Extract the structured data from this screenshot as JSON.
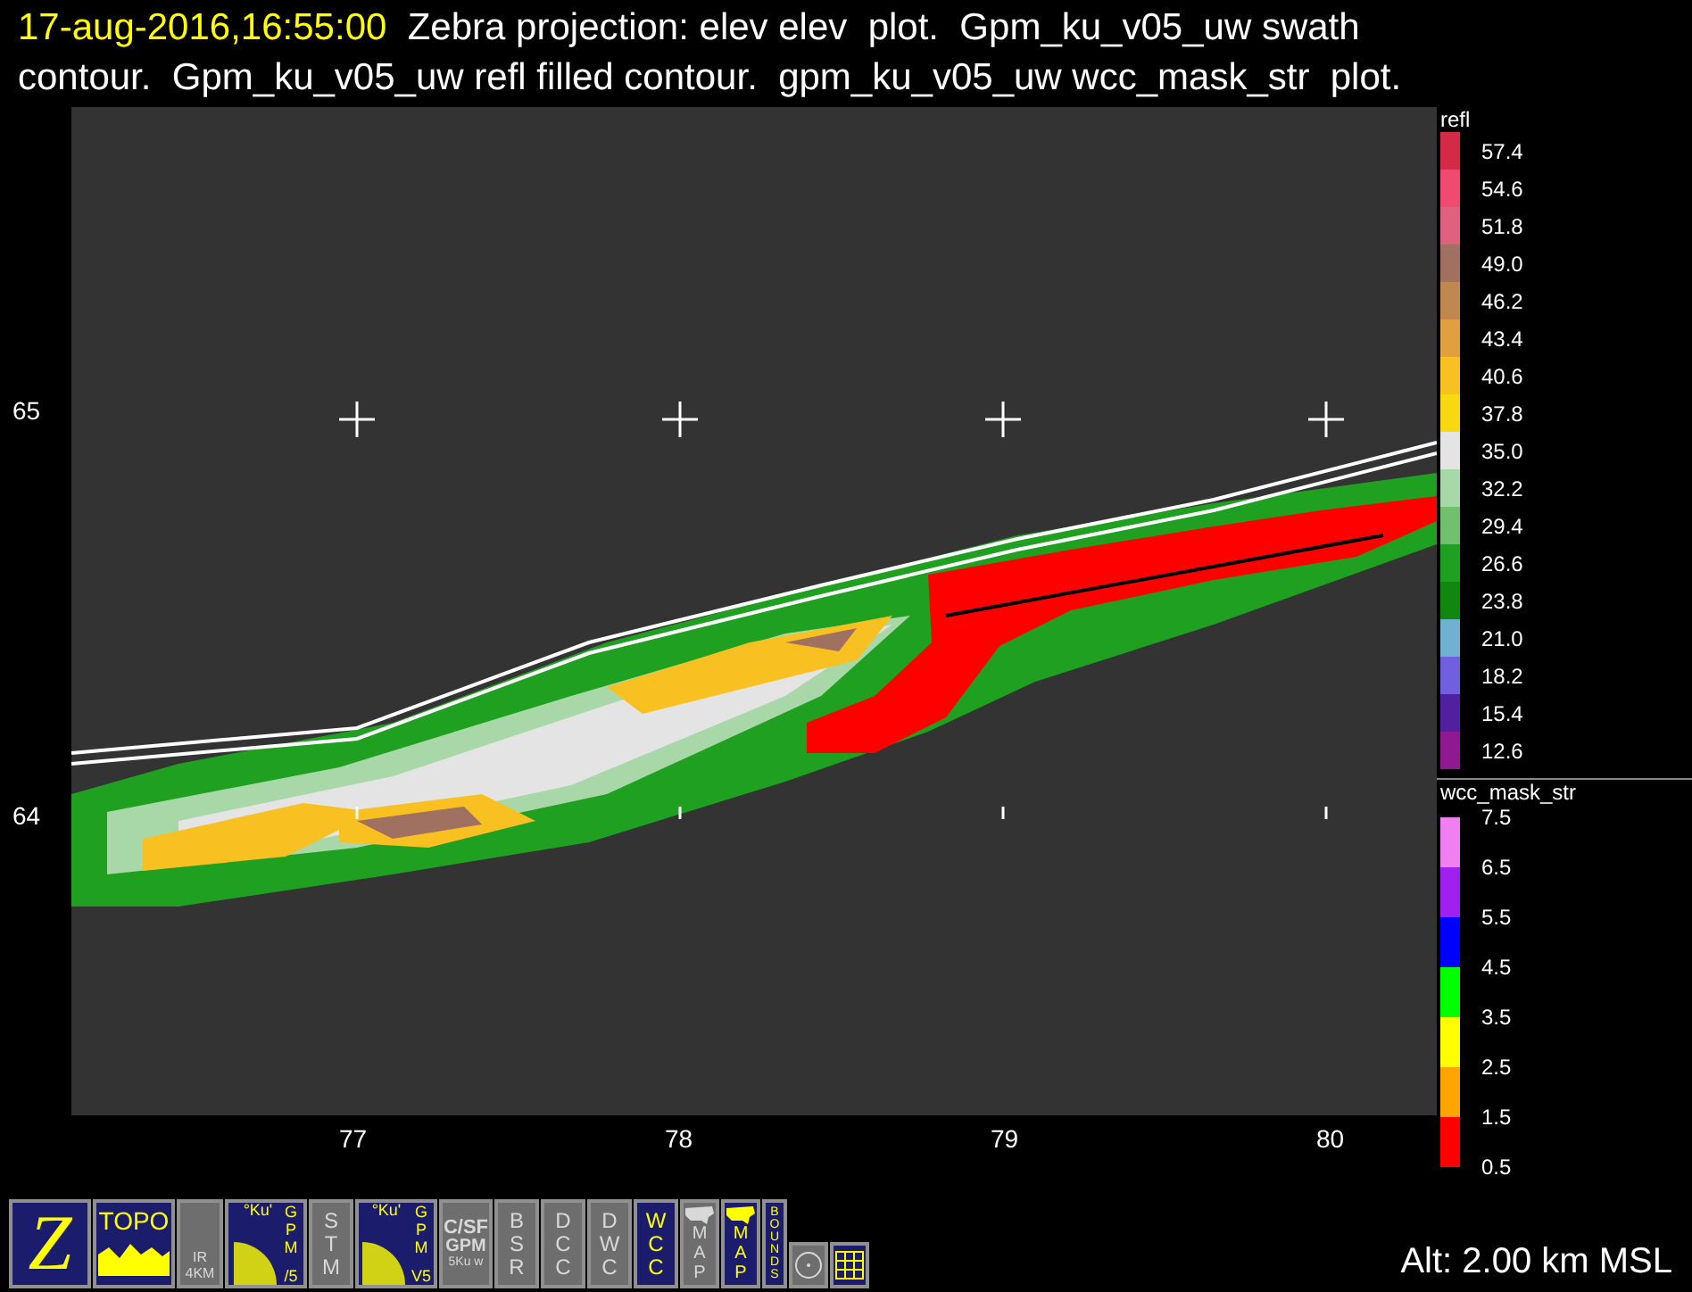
{
  "header": {
    "time": "17-aug-2016,16:55:00",
    "lines": [
      "Zebra projection: elev elev  plot.  Gpm_ku_v05_uw swath",
      "contour.  Gpm_ku_v05_uw refl filled contour.  gpm_ku_v05_uw wcc_mask_str  plot."
    ]
  },
  "plot": {
    "y_ticks": [
      "65",
      "64"
    ],
    "x_ticks": [
      "77",
      "78",
      "79",
      "80"
    ]
  },
  "refl_legend": {
    "title": "refl",
    "items": [
      {
        "label": "57.4",
        "color": "#d42a48"
      },
      {
        "label": "54.6",
        "color": "#f04a70"
      },
      {
        "label": "51.8",
        "color": "#e06080"
      },
      {
        "label": "49.0",
        "color": "#a07060"
      },
      {
        "label": "46.2",
        "color": "#c08850"
      },
      {
        "label": "43.4",
        "color": "#e0a040"
      },
      {
        "label": "40.6",
        "color": "#f8c020"
      },
      {
        "label": "37.8",
        "color": "#f8d810"
      },
      {
        "label": "35.0",
        "color": "#e4e4e4"
      },
      {
        "label": "32.2",
        "color": "#a8d8a8"
      },
      {
        "label": "29.4",
        "color": "#70c070"
      },
      {
        "label": "26.6",
        "color": "#20a020"
      },
      {
        "label": "23.8",
        "color": "#108810"
      },
      {
        "label": "21.0",
        "color": "#70b0d0"
      },
      {
        "label": "18.2",
        "color": "#7060e0"
      },
      {
        "label": "15.4",
        "color": "#5020a0"
      },
      {
        "label": "12.6",
        "color": "#901890"
      }
    ]
  },
  "wcc_legend": {
    "title": "wcc_mask_str",
    "labels": [
      "7.5",
      "6.5",
      "5.5",
      "4.5",
      "3.5",
      "2.5",
      "1.5",
      "0.5"
    ],
    "segments": [
      {
        "color": "#f080f0"
      },
      {
        "color": "#a020f0"
      },
      {
        "color": "#0000ff"
      },
      {
        "color": "#00ff00"
      },
      {
        "color": "#ffff00"
      },
      {
        "color": "#ffa500"
      },
      {
        "color": "#ff0000"
      }
    ]
  },
  "toolbar": [
    {
      "kind": "z",
      "active": true,
      "text": "Z"
    },
    {
      "kind": "topo",
      "active": true,
      "text": "TOPO"
    },
    {
      "kind": "ir",
      "active": false,
      "lines": [
        "IR",
        "4KM"
      ]
    },
    {
      "kind": "gpm",
      "active": true,
      "badge": "°Ku'",
      "side": "GPM",
      "version": "/5"
    },
    {
      "kind": "vertical",
      "active": false,
      "text": "STM"
    },
    {
      "kind": "gpm",
      "active": true,
      "badge": "°Ku'",
      "side": "GPM",
      "version": "V5"
    },
    {
      "kind": "csf",
      "active": false,
      "lines": [
        "C/SF",
        "GPM",
        "5Ku w"
      ]
    },
    {
      "kind": "vertical",
      "active": false,
      "text": "BSR"
    },
    {
      "kind": "vertical",
      "active": false,
      "text": "DCC"
    },
    {
      "kind": "vertical",
      "active": false,
      "text": "DWC"
    },
    {
      "kind": "vertical",
      "active": true,
      "text": "WCC"
    },
    {
      "kind": "map",
      "active": false,
      "text": "MAP"
    },
    {
      "kind": "map",
      "active": true,
      "text": "MAP"
    },
    {
      "kind": "small",
      "active": true,
      "text": "BOUNDS"
    },
    {
      "kind": "circle",
      "active": false
    },
    {
      "kind": "grid",
      "active": true
    }
  ],
  "altitude": "Alt: 2.00 km MSL"
}
